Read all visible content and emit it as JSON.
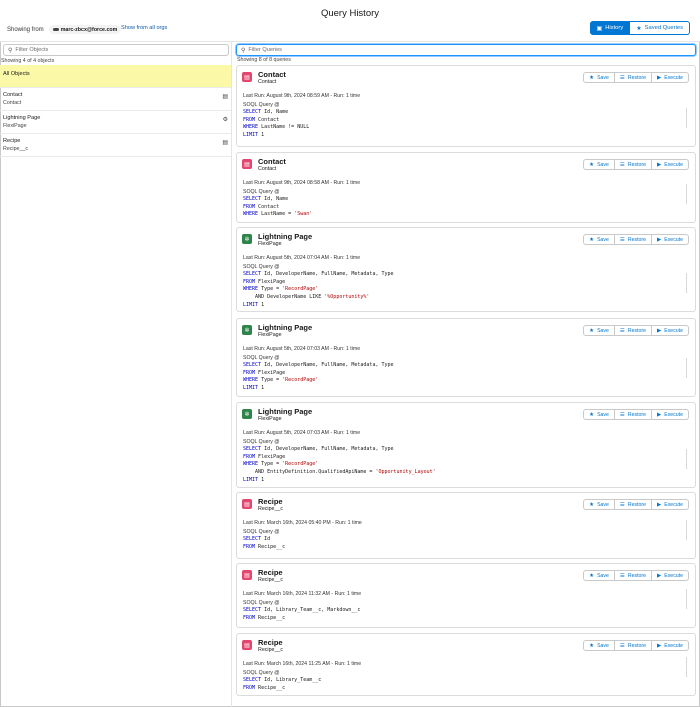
{
  "header": {
    "title": "Query History",
    "showing_from": "Showing from",
    "org": "marc-zbcx@force.com",
    "show_all_orgs": "Show from all orgs",
    "history_label": "History",
    "saved_label": "Saved Queries"
  },
  "left": {
    "filter_placeholder": "Filter Objects",
    "count_text": "Showing 4 of 4 objects",
    "items": [
      {
        "name": "All Objects",
        "api": ""
      },
      {
        "name": "Contact",
        "api": "Contact",
        "icon": "clipboard-icon"
      },
      {
        "name": "Lightning Page",
        "api": "FlexiPage",
        "icon": "gear-icon"
      },
      {
        "name": "Recipe",
        "api": "Recipe__c",
        "icon": "clipboard-icon"
      }
    ]
  },
  "right": {
    "filter_placeholder": "Filter Queries",
    "count_text": "Showing 8 of 8 queries",
    "save_label": "Save",
    "restore_label": "Restore",
    "execute_label": "Execute",
    "query_label": "SOQL Query @",
    "cards": [
      {
        "title": "Contact",
        "sub": "Contact",
        "icon": "pink",
        "last_run": "Last Run: August 9th, 2024 08:59 AM - Run: 1 time",
        "lines": [
          [
            [
              "k",
              "SELECT"
            ],
            [
              "t",
              " Id, Name"
            ]
          ],
          [
            [
              "k",
              "FROM"
            ],
            [
              "t",
              " Contact"
            ]
          ],
          [
            [
              "k",
              "WHERE"
            ],
            [
              "t",
              " LastName != NULL"
            ]
          ],
          [
            [
              "k",
              "LIMIT"
            ],
            [
              "t",
              " 1"
            ]
          ]
        ]
      },
      {
        "title": "Contact",
        "sub": "Contact",
        "icon": "pink",
        "last_run": "Last Run: August 9th, 2024 08:58 AM - Run: 1 time",
        "lines": [
          [
            [
              "k",
              "SELECT"
            ],
            [
              "t",
              " Id, Name"
            ]
          ],
          [
            [
              "k",
              "FROM"
            ],
            [
              "t",
              " Contact"
            ]
          ],
          [
            [
              "k",
              "WHERE"
            ],
            [
              "t",
              " LastName = "
            ],
            [
              "s",
              "'Swan'"
            ]
          ]
        ]
      },
      {
        "title": "Lightning Page",
        "sub": "FlexiPage",
        "icon": "green",
        "last_run": "Last Run: August 5th, 2024 07:04 AM - Run: 1 time",
        "lines": [
          [
            [
              "k",
              "SELECT"
            ],
            [
              "t",
              " Id, DeveloperName, FullName, Metadata, Type"
            ]
          ],
          [
            [
              "k",
              "FROM"
            ],
            [
              "t",
              " FlexiPage"
            ]
          ],
          [
            [
              "k",
              "WHERE"
            ],
            [
              "t",
              " Type = "
            ],
            [
              "s",
              "'RecordPage'"
            ]
          ],
          [
            [
              "t",
              "    AND DeveloperName LIKE "
            ],
            [
              "s",
              "'%Opportunity%'"
            ]
          ],
          [
            [
              "k",
              "LIMIT"
            ],
            [
              "t",
              " 1"
            ]
          ]
        ]
      },
      {
        "title": "Lightning Page",
        "sub": "FlexiPage",
        "icon": "green",
        "last_run": "Last Run: August 5th, 2024 07:03 AM - Run: 1 time",
        "lines": [
          [
            [
              "k",
              "SELECT"
            ],
            [
              "t",
              " Id, DeveloperName, FullName, Metadata, Type"
            ]
          ],
          [
            [
              "k",
              "FROM"
            ],
            [
              "t",
              " FlexiPage"
            ]
          ],
          [
            [
              "k",
              "WHERE"
            ],
            [
              "t",
              " Type = "
            ],
            [
              "s",
              "'RecordPage'"
            ]
          ],
          [
            [
              "k",
              "LIMIT"
            ],
            [
              "t",
              " 1"
            ]
          ]
        ]
      },
      {
        "title": "Lightning Page",
        "sub": "FlexiPage",
        "icon": "green",
        "last_run": "Last Run: August 5th, 2024 07:03 AM - Run: 1 time",
        "lines": [
          [
            [
              "k",
              "SELECT"
            ],
            [
              "t",
              " Id, DeveloperName, FullName, Metadata, Type"
            ]
          ],
          [
            [
              "k",
              "FROM"
            ],
            [
              "t",
              " FlexiPage"
            ]
          ],
          [
            [
              "k",
              "WHERE"
            ],
            [
              "t",
              " Type = "
            ],
            [
              "s",
              "'RecordPage'"
            ]
          ],
          [
            [
              "t",
              "    AND EntityDefinition.QualifiedApiName = "
            ],
            [
              "s",
              "'Opportunity_Layout'"
            ]
          ],
          [
            [
              "k",
              "LIMIT"
            ],
            [
              "t",
              " 1"
            ]
          ]
        ]
      },
      {
        "title": "Recipe",
        "sub": "Recipe__c",
        "icon": "pink",
        "last_run": "Last Run: March 16th, 2024 05:40 PM - Run: 1 time",
        "lines": [
          [
            [
              "k",
              "SELECT"
            ],
            [
              "t",
              " Id"
            ]
          ],
          [
            [
              "k",
              "FROM"
            ],
            [
              "t",
              " Recipe__c"
            ]
          ]
        ]
      },
      {
        "title": "Recipe",
        "sub": "Recipe__c",
        "icon": "pink",
        "last_run": "Last Run: March 16th, 2024 11:32 AM - Run: 1 time",
        "lines": [
          [
            [
              "k",
              "SELECT"
            ],
            [
              "t",
              " Id, Library_Team__c, Markdown__c"
            ]
          ],
          [
            [
              "k",
              "FROM"
            ],
            [
              "t",
              " Recipe__c"
            ]
          ]
        ]
      },
      {
        "title": "Recipe",
        "sub": "Recipe__c",
        "icon": "pink",
        "last_run": "Last Run: March 16th, 2024 11:25 AM - Run: 1 time",
        "lines": [
          [
            [
              "k",
              "SELECT"
            ],
            [
              "t",
              " Id, Library_Team__c"
            ]
          ],
          [
            [
              "k",
              "FROM"
            ],
            [
              "t",
              " Recipe__c"
            ]
          ]
        ]
      }
    ]
  }
}
